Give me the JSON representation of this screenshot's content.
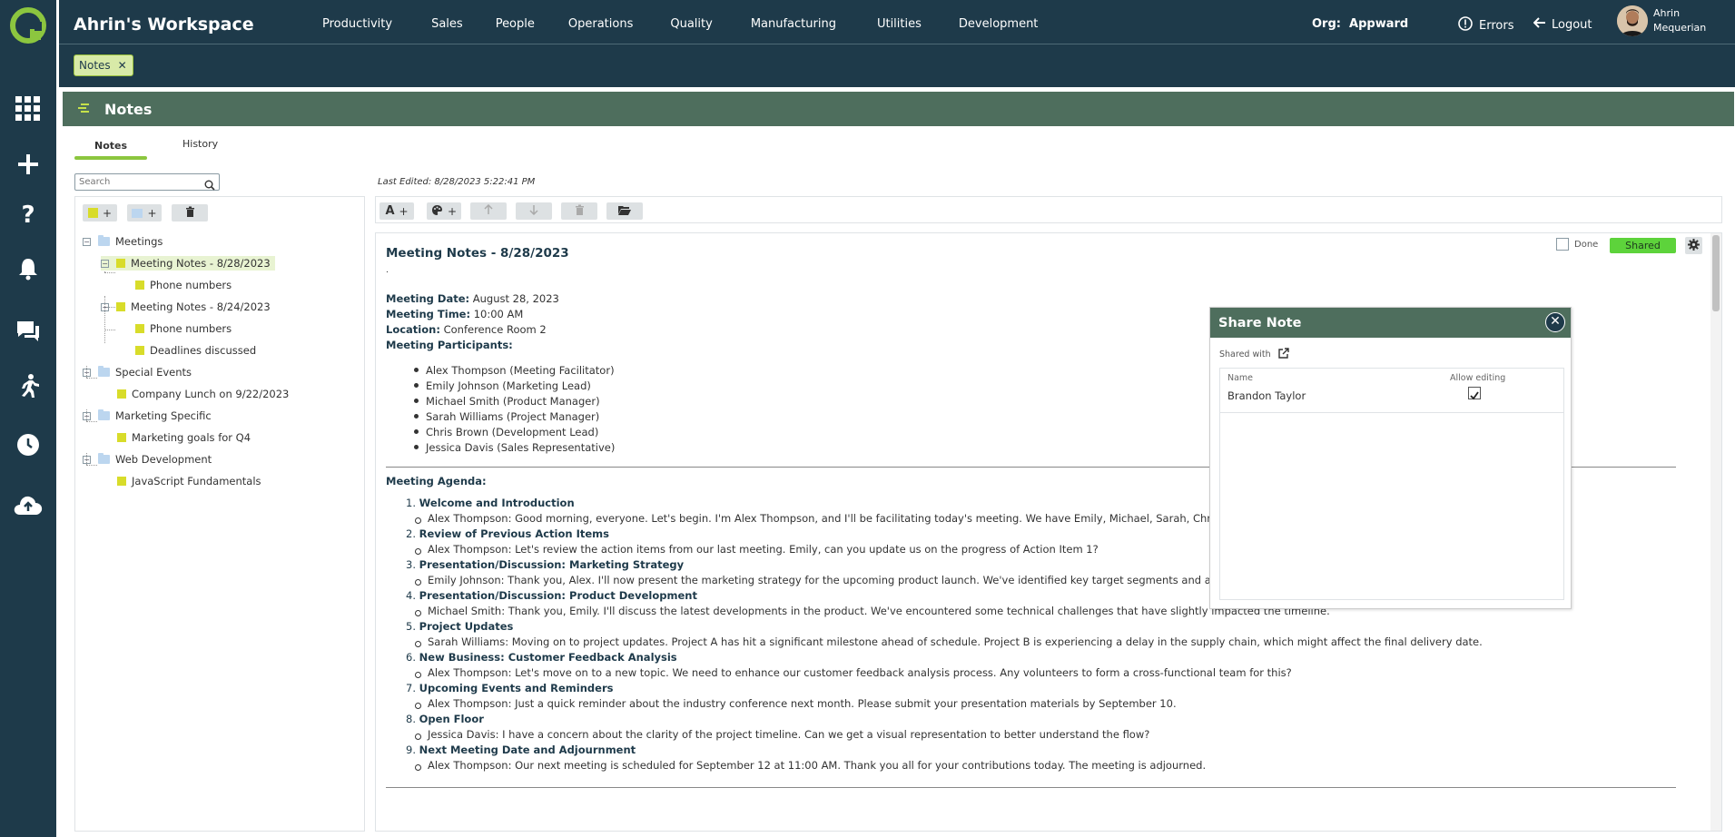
{
  "app": {
    "workspace": "Ahrin's Workspace",
    "nav": [
      "Productivity",
      "Sales",
      "People",
      "Operations",
      "Quality",
      "Manufacturing",
      "Utilities",
      "Development"
    ],
    "org_label": "Org:",
    "org_value": "Appward",
    "errors_label": "Errors",
    "logout_label": "Logout",
    "user_first": "Ahrin",
    "user_last": "Mequerian",
    "open_tab": "Notes",
    "brand_color": "#1e3a4a",
    "accent_color": "#8cc63f"
  },
  "rail": {
    "icons": [
      "apps-grid-icon",
      "plus-icon",
      "help-icon",
      "bell-icon",
      "chat-icon",
      "runner-icon",
      "clock-icon",
      "cloud-upload-icon"
    ]
  },
  "page": {
    "title": "Notes",
    "tabs": [
      "Notes",
      "History"
    ],
    "search_placeholder": "Search",
    "last_edited": "Last Edited: 8/28/2023 5:22:41 PM"
  },
  "tree": {
    "items": [
      {
        "label": "Meetings",
        "type": "folder"
      },
      {
        "label": "Meeting Notes - 8/28/2023",
        "type": "note",
        "selected": true
      },
      {
        "label": "Phone numbers",
        "type": "note"
      },
      {
        "label": "Meeting Notes - 8/24/2023",
        "type": "note"
      },
      {
        "label": "Phone numbers",
        "type": "note"
      },
      {
        "label": "Deadlines discussed",
        "type": "note"
      },
      {
        "label": "Special Events",
        "type": "folder"
      },
      {
        "label": "Company Lunch on 9/22/2023",
        "type": "note"
      },
      {
        "label": "Marketing Specific",
        "type": "folder"
      },
      {
        "label": "Marketing goals for Q4",
        "type": "note"
      },
      {
        "label": "Web Development",
        "type": "folder"
      },
      {
        "label": "JavaScript Fundamentals",
        "type": "note"
      }
    ]
  },
  "note": {
    "title": "Meeting Notes - 8/28/2023",
    "dot": ".",
    "done_label": "Done",
    "shared_label": "Shared",
    "date_label": "Meeting Date:",
    "date_value": "August 28, 2023",
    "time_label": "Meeting Time:",
    "time_value": "10:00 AM",
    "location_label": "Location:",
    "location_value": "Conference Room 2",
    "participants_label": "Meeting Participants:",
    "participants": [
      "Alex Thompson (Meeting Facilitator)",
      "Emily Johnson (Marketing Lead)",
      "Michael Smith (Product Manager)",
      "Sarah Williams (Project Manager)",
      "Chris Brown (Development Lead)",
      "Jessica Davis (Sales Representative)"
    ],
    "agenda_label": "Meeting Agenda:",
    "agenda": [
      {
        "n": "1.",
        "title": "Welcome and Introduction",
        "text": "Alex Thompson: Good morning, everyone. Let's begin. I'm Alex Thompson, and I'll be facilitating today's meeting. We have Emily, Michael, Sarah, Chris, an"
      },
      {
        "n": "2.",
        "title": "Review of Previous Action Items",
        "text": "Alex Thompson: Let's review the action items from our last meeting. Emily, can you update us on the progress of Action Item 1?"
      },
      {
        "n": "3.",
        "title": "Presentation/Discussion: Marketing Strategy",
        "text": "Emily Johnson: Thank you, Alex. I'll now present the marketing strategy for the upcoming product launch. We've identified key target segments and are"
      },
      {
        "n": "4.",
        "title": "Presentation/Discussion: Product Development",
        "text": "Michael Smith: Thank you, Emily. I'll discuss the latest developments in the product. We've encountered some technical challenges that have slightly impacted the timeline."
      },
      {
        "n": "5.",
        "title": "Project Updates",
        "text": "Sarah Williams: Moving on to project updates. Project A has hit a significant milestone ahead of schedule. Project B is experiencing a delay in the supply chain, which might affect the final delivery date."
      },
      {
        "n": "6.",
        "title": "New Business: Customer Feedback Analysis",
        "text": "Alex Thompson: Let's move on to a new topic. We need to enhance our customer feedback analysis process. Any volunteers to form a cross-functional team for this?"
      },
      {
        "n": "7.",
        "title": "Upcoming Events and Reminders",
        "text": "Alex Thompson: Just a quick reminder about the industry conference next month. Please submit your presentation materials by September 10."
      },
      {
        "n": "8.",
        "title": "Open Floor",
        "text": "Jessica Davis: I have a concern about the clarity of the project timeline. Can we get a visual representation to better understand the flow?"
      },
      {
        "n": "9.",
        "title": "Next Meeting Date and Adjournment",
        "text": "Alex Thompson: Our next meeting is scheduled for September 12 at 11:00 AM. Thank you all for your contributions today. The meeting is adjourned."
      }
    ]
  },
  "share_modal": {
    "title": "Share Note",
    "shared_with_label": "Shared with",
    "col_name": "Name",
    "col_allow": "Allow editing",
    "rows": [
      {
        "name": "Brandon Taylor",
        "allow_editing": true
      }
    ]
  }
}
